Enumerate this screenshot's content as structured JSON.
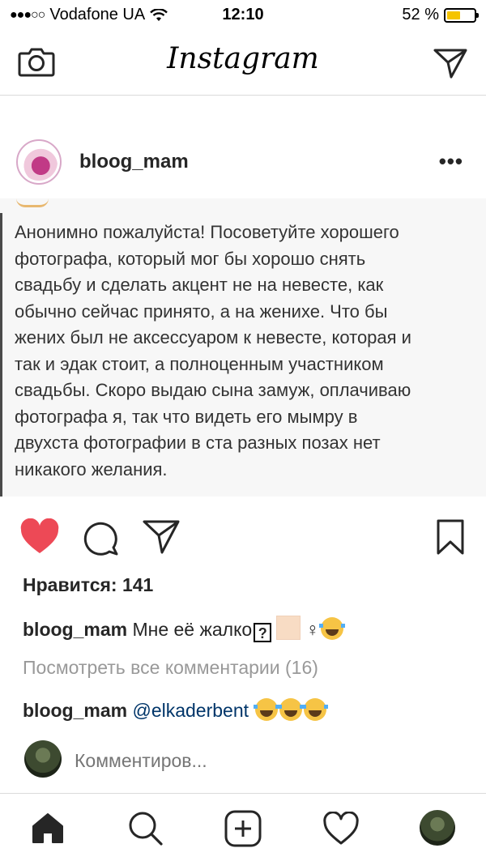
{
  "status_bar": {
    "carrier": "Vodafone UA",
    "time": "12:10",
    "battery": "52 %",
    "battery_level": 0.52
  },
  "nav": {
    "logo": "Instagram",
    "camera_icon": "camera-icon",
    "direct_icon": "paper-plane-icon"
  },
  "post": {
    "username": "bloog_mam",
    "more_icon": "•••",
    "image_text": "Анонимно пожалуйста! Посоветуйте хорошего\nфотографа, который мог бы хорошо снять\nсвадьбу и сделать акцент не на невесте, как\nобычно сейчас принято, а на женихе. Что бы\nжених был не аксессуаром к невесте, которая и\nтак и эдак стоит, а полноценным участником\nсвадьбы. Скоро выдаю сына замуж, оплачиваю\nфотографа я, так что видеть его мымру в\nдвухста фотографии в ста разных позах нет\nникакого желания.",
    "likes": "Нравится: 141",
    "caption_user": "bloog_mam",
    "caption_text": "Мне её жалко",
    "caption_box": "?",
    "caption_female_sign": "♀",
    "view_comments": "Посмотреть все комментарии (16)",
    "comment_user": "bloog_mam",
    "comment_mention": "@elkaderbent",
    "comment_placeholder": "Комментиров..."
  },
  "colors": {
    "like_red": "#ed4956",
    "mention_blue": "#003569",
    "muted_gray": "#999999"
  }
}
